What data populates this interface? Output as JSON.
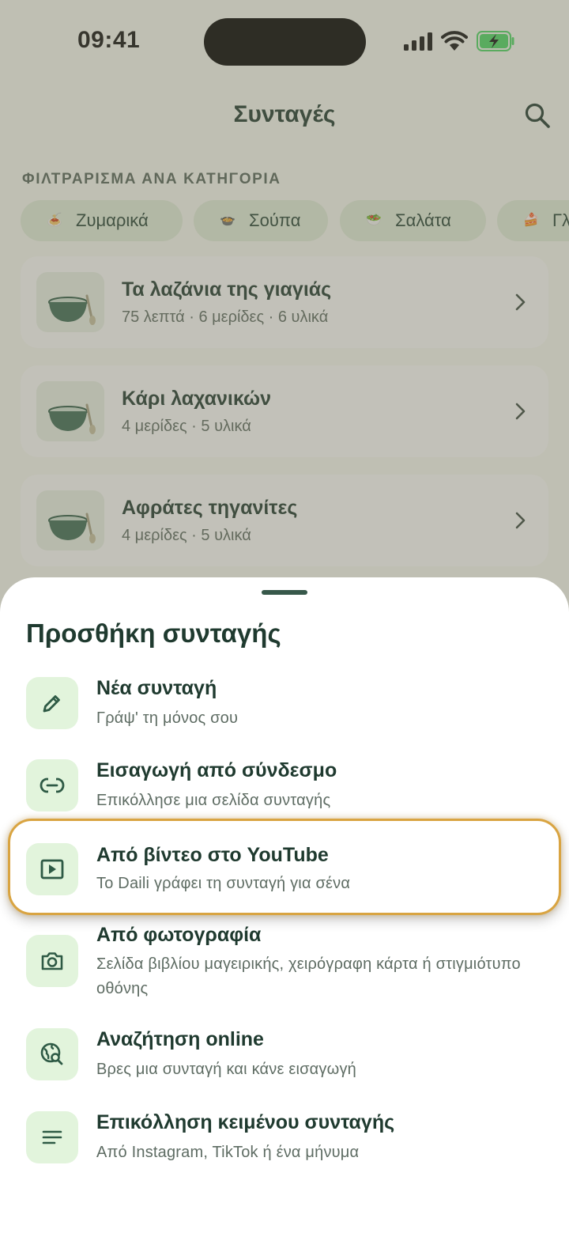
{
  "status_bar": {
    "time": "09:41"
  },
  "header": {
    "title": "Συνταγές"
  },
  "filter": {
    "label": "ΦΙΛΤΡΑΡΙΣΜΑ ΑΝΑ ΚΑΤΗΓΟΡΙΑ",
    "chips": [
      {
        "label": "Ζυμαρικά",
        "emoji": "🍝"
      },
      {
        "label": "Σούπα",
        "emoji": "🍲"
      },
      {
        "label": "Σαλάτα",
        "emoji": "🥗"
      },
      {
        "label": "Γλ",
        "emoji": "🍰"
      }
    ]
  },
  "recipes": [
    {
      "name": "Τα λαζάνια της γιαγιάς",
      "meta": "75 λεπτά · 6 μερίδες · 6 υλικά"
    },
    {
      "name": "Κάρι λαχανικών",
      "meta": "4 μερίδες · 5 υλικά"
    },
    {
      "name": "Αφράτες τηγανίτες",
      "meta": "4 μερίδες · 5 υλικά"
    }
  ],
  "sheet": {
    "title": "Προσθήκη συνταγής",
    "options": [
      {
        "title": "Νέα συνταγή",
        "subtitle": "Γράψ' τη μόνος σου",
        "icon": "pencil-icon"
      },
      {
        "title": "Εισαγωγή από σύνδεσμο",
        "subtitle": "Επικόλλησε μια σελίδα συνταγής",
        "icon": "link-icon"
      },
      {
        "title": "Από βίντεο στο YouTube",
        "subtitle": "Το Daili γράφει τη συνταγή για σένα",
        "icon": "video-icon",
        "highlighted": true
      },
      {
        "title": "Από φωτογραφία",
        "subtitle": "Σελίδα βιβλίου μαγειρικής, χειρόγραφη κάρτα ή στιγμιότυπο οθόνης",
        "icon": "camera-icon"
      },
      {
        "title": "Αναζήτηση online",
        "subtitle": "Βρες μια συνταγή και κάνε εισαγωγή",
        "icon": "globe-search-icon"
      },
      {
        "title": "Επικόλληση κειμένου συνταγής",
        "subtitle": "Από Instagram, TikTok ή ένα μήνυμα",
        "icon": "text-lines-icon"
      }
    ]
  },
  "colors": {
    "accent_dark": "#1f3a2f",
    "icon_green": "#2e5a45",
    "icon_bg": "#e2f4dc",
    "highlight": "#d9a441",
    "battery": "#4cd964"
  }
}
